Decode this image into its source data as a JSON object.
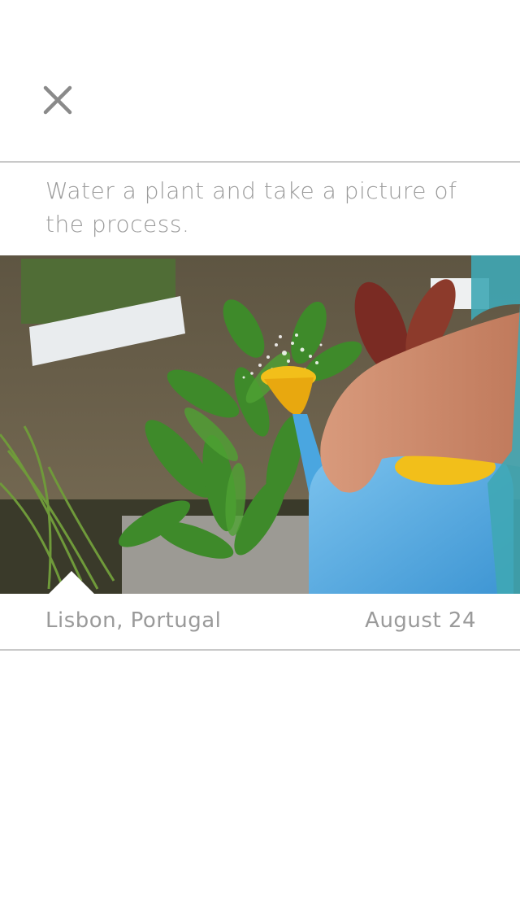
{
  "header": {
    "close_icon": "close-icon"
  },
  "card": {
    "caption": "Water a plant and take a picture of the process.",
    "photo_description_icon": "photo-image",
    "location": "Lisbon, Portugal",
    "date": "August 24"
  },
  "colors": {
    "background": "#ffffff",
    "text": "#9a9a9a",
    "divider": "#c9c9c9",
    "icon": "#8a8a8a"
  }
}
